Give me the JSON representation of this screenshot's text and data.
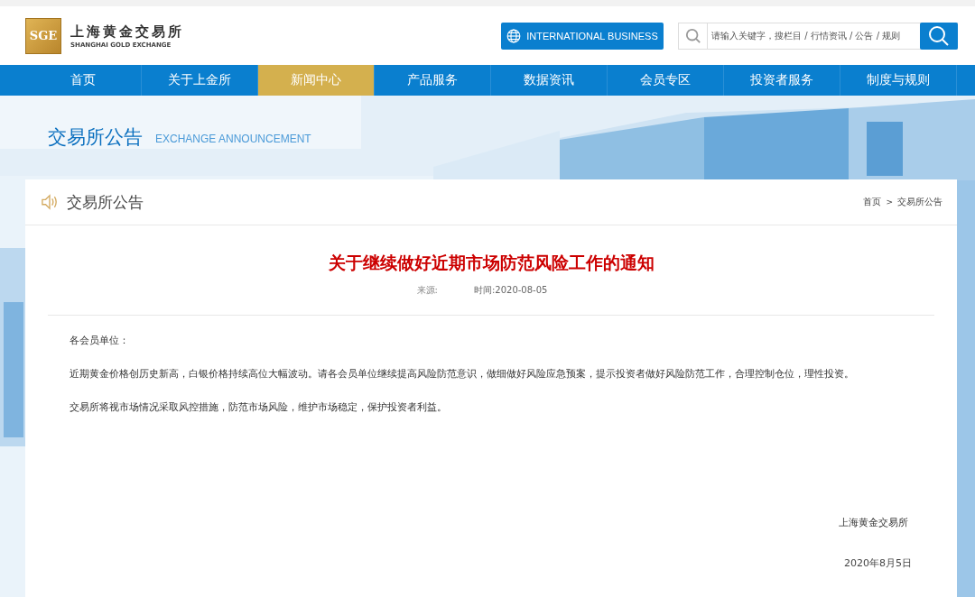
{
  "logo": {
    "mark": "SGE",
    "name_cn": "上海黄金交易所",
    "name_en": "SHANGHAI GOLD EXCHANGE"
  },
  "intl_button": {
    "label": "INTERNATIONAL BUSINESS"
  },
  "search": {
    "placeholder": "请输入关键字，搜栏目 / 行情资讯 / 公告 / 规则"
  },
  "nav": [
    {
      "label": "首页",
      "selected": false
    },
    {
      "label": "关于上金所",
      "selected": false
    },
    {
      "label": "新闻中心",
      "selected": true
    },
    {
      "label": "产品服务",
      "selected": false
    },
    {
      "label": "数据资讯",
      "selected": false
    },
    {
      "label": "会员专区",
      "selected": false
    },
    {
      "label": "投资者服务",
      "selected": false
    },
    {
      "label": "制度与规则",
      "selected": false
    }
  ],
  "banner": {
    "title": "交易所公告",
    "subtitle": "EXCHANGE ANNOUNCEMENT"
  },
  "section": {
    "title": "交易所公告",
    "breadcrumb": [
      {
        "label": "首页"
      },
      {
        "label": "交易所公告"
      }
    ],
    "separator": ">"
  },
  "article": {
    "title": "关于继续做好近期市场防范风险工作的通知",
    "source_label": "来源:",
    "time_label": "时间:2020-08-05",
    "paragraphs": [
      "各会员单位：",
      "近期黄金价格创历史新高，白银价格持续高位大幅波动。请各会员单位继续提高风险防范意识，做细做好风险应急预案，提示投资者做好风险防范工作，合理控制仓位，理性投资。",
      "交易所将视市场情况采取风控措施，防范市场风险，维护市场稳定，保护投资者利益。"
    ],
    "signature": "上海黄金交易所",
    "date": "2020年8月5日"
  }
}
